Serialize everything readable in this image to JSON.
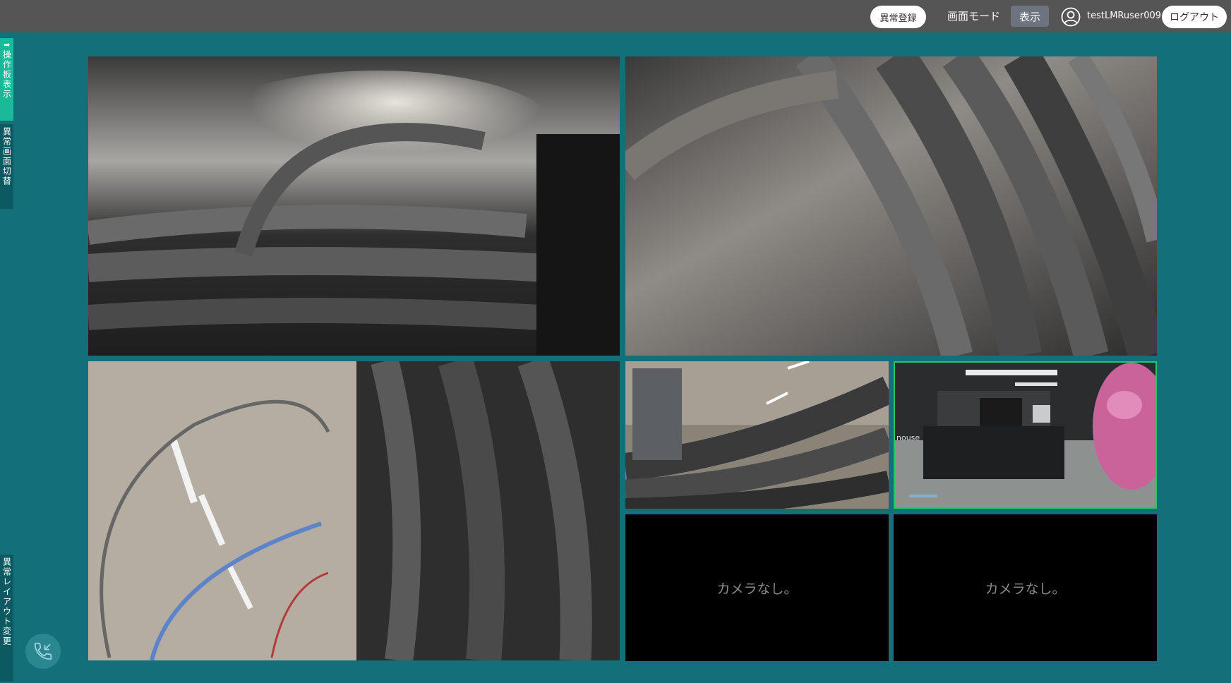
{
  "header": {
    "anomaly_register_label": "異常登録",
    "screen_mode_label": "画面モード",
    "display_label": "表示",
    "username": "testLMRuser009",
    "logout_label": "ログアウト",
    "user_icon": "user-circle-icon"
  },
  "side_tabs": {
    "panel_toggle_arrow": "➡",
    "panel_toggle_label": "操作板表示",
    "screen_switch_label": "異常画面切替",
    "layout_change_label": "異常レイアウト変更"
  },
  "phone": {
    "icon": "phone-incoming-icon"
  },
  "cameras": [
    {
      "id": 1,
      "status": "live"
    },
    {
      "id": 2,
      "status": "live"
    },
    {
      "id": 3,
      "status": "live"
    },
    {
      "id": 4,
      "status": "live"
    },
    {
      "id": 5,
      "status": "live",
      "selected": true,
      "overlay_text": "nouse"
    },
    {
      "id": 6,
      "status": "empty",
      "message": "カメラなし。"
    },
    {
      "id": 7,
      "status": "empty",
      "message": "カメラなし。"
    }
  ],
  "colors": {
    "background": "#136f79",
    "topbar": "#555555",
    "panel_tab": "#19b999",
    "side_tab": "#0c5961",
    "selected_border": "#27c46c"
  }
}
